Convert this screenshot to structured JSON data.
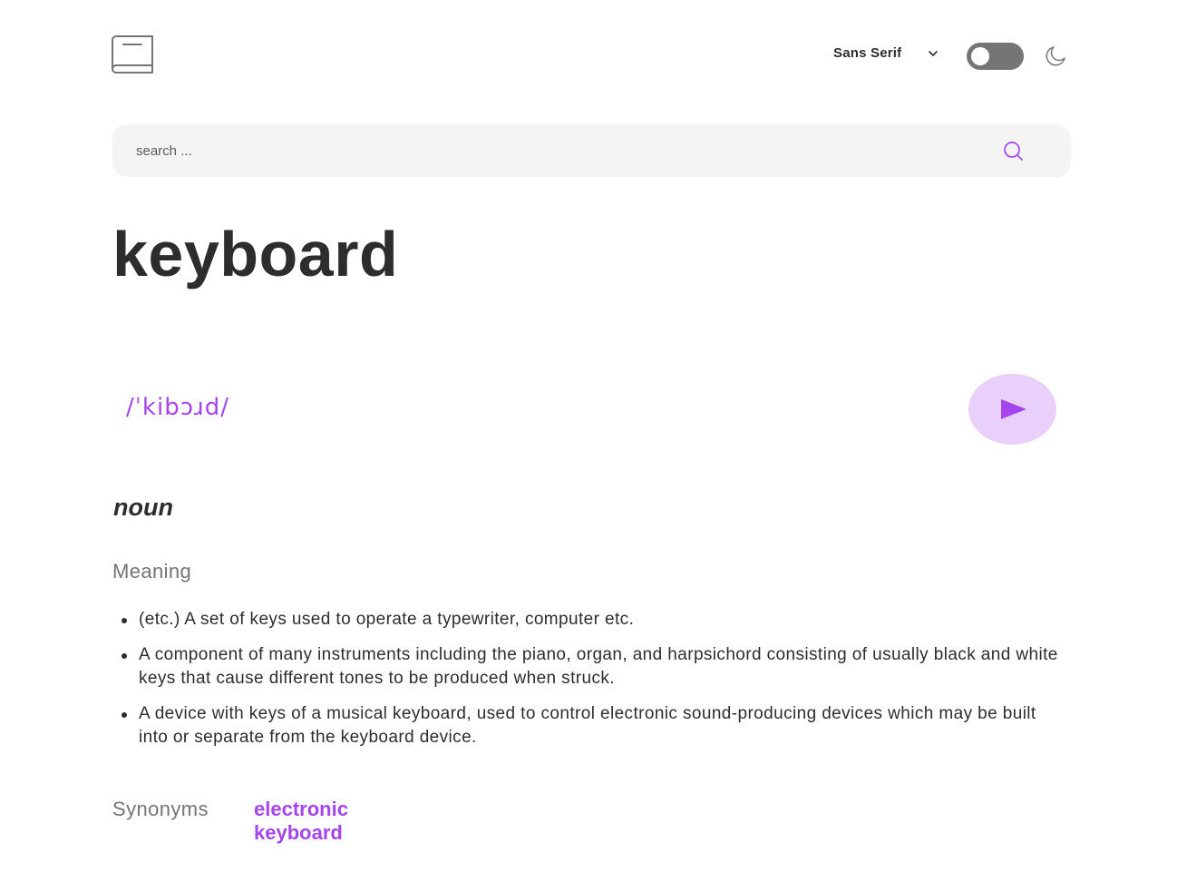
{
  "header": {
    "logo_icon": "book-icon",
    "font_select": {
      "selected": "Sans Serif",
      "icon": "chevron-down-icon"
    },
    "theme_toggle": {
      "state": "off"
    },
    "theme_icon": "moon-icon"
  },
  "search": {
    "placeholder": "search ...",
    "value": "",
    "icon": "search-icon"
  },
  "entry": {
    "word": "keyboard",
    "phonetic": "/ˈkibɔɹd/",
    "play_icon": "play-icon"
  },
  "meanings": [
    {
      "part_of_speech": "noun",
      "heading": "Meaning",
      "definitions": [
        "(etc.) A set of keys used to operate a typewriter, computer etc.",
        "A component of many instruments including the piano, organ, and harpsichord consisting of usually black and white keys that cause different tones to be produced when struck.",
        "A device with keys of a musical keyboard, used to control electronic sound-producing devices which may be built into or separate from the keyboard device."
      ],
      "synonyms_heading": "Synonyms",
      "synonyms": [
        "electronic keyboard"
      ]
    }
  ],
  "colors": {
    "accent": "#a445ed",
    "accent_light": "#e9d0fa",
    "text": "#2d2d2d",
    "muted": "#757575",
    "search_bg": "#f4f4f4",
    "toggle_bg": "#757575"
  }
}
